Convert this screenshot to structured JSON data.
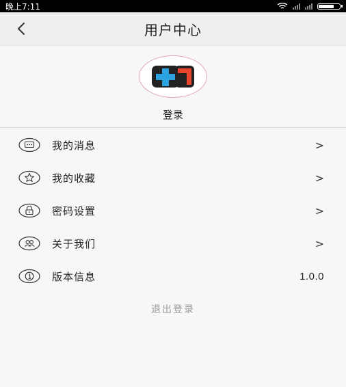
{
  "status_bar": {
    "time": "晚上7:11"
  },
  "header": {
    "title": "用户中心"
  },
  "profile": {
    "login_label": "登录"
  },
  "menu": {
    "items": [
      {
        "label": "我的消息",
        "icon": "message-icon",
        "trailing": ">"
      },
      {
        "label": "我的收藏",
        "icon": "star-icon",
        "trailing": ">"
      },
      {
        "label": "密码设置",
        "icon": "lock-icon",
        "trailing": ">"
      },
      {
        "label": "关于我们",
        "icon": "users-icon",
        "trailing": ">"
      },
      {
        "label": "版本信息",
        "icon": "info-icon",
        "trailing": "1.0.0"
      }
    ]
  },
  "footer": {
    "logout_label": "退出登录"
  },
  "colors": {
    "avatar_border": "#e2a6ad",
    "logout_text": "#9a9a9a",
    "logo_blue": "#2aa3e0",
    "logo_red": "#e8442e"
  }
}
